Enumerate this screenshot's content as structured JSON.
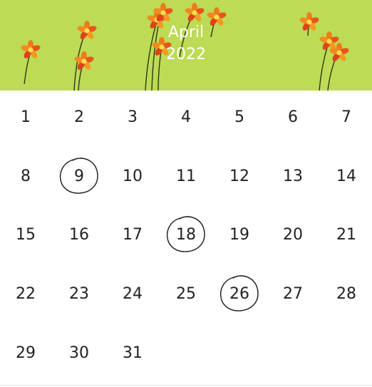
{
  "calendar": {
    "month": "April",
    "year": "2022",
    "colors": {
      "header_background": "#bddb55",
      "title_text": "#ffffff",
      "day_text": "#222222",
      "circle_stroke": "#1a1a1a"
    },
    "header_decoration_icon": "flower-icon",
    "circle_mark_icon": "hand-drawn-circle-icon",
    "weeks": [
      [
        {
          "label": "1",
          "circled": false
        },
        {
          "label": "2",
          "circled": false
        },
        {
          "label": "3",
          "circled": false
        },
        {
          "label": "4",
          "circled": false
        },
        {
          "label": "5",
          "circled": false
        },
        {
          "label": "6",
          "circled": false
        },
        {
          "label": "7",
          "circled": false
        }
      ],
      [
        {
          "label": "8",
          "circled": false
        },
        {
          "label": "9",
          "circled": true
        },
        {
          "label": "10",
          "circled": false
        },
        {
          "label": "11",
          "circled": false
        },
        {
          "label": "12",
          "circled": false
        },
        {
          "label": "13",
          "circled": false
        },
        {
          "label": "14",
          "circled": false
        }
      ],
      [
        {
          "label": "15",
          "circled": false
        },
        {
          "label": "16",
          "circled": false
        },
        {
          "label": "17",
          "circled": false
        },
        {
          "label": "18",
          "circled": true
        },
        {
          "label": "19",
          "circled": false
        },
        {
          "label": "20",
          "circled": false
        },
        {
          "label": "21",
          "circled": false
        }
      ],
      [
        {
          "label": "22",
          "circled": false
        },
        {
          "label": "23",
          "circled": false
        },
        {
          "label": "24",
          "circled": false
        },
        {
          "label": "25",
          "circled": false
        },
        {
          "label": "26",
          "circled": true
        },
        {
          "label": "27",
          "circled": false
        },
        {
          "label": "28",
          "circled": false
        }
      ],
      [
        {
          "label": "29",
          "circled": false
        },
        {
          "label": "30",
          "circled": false
        },
        {
          "label": "31",
          "circled": false
        }
      ]
    ]
  }
}
